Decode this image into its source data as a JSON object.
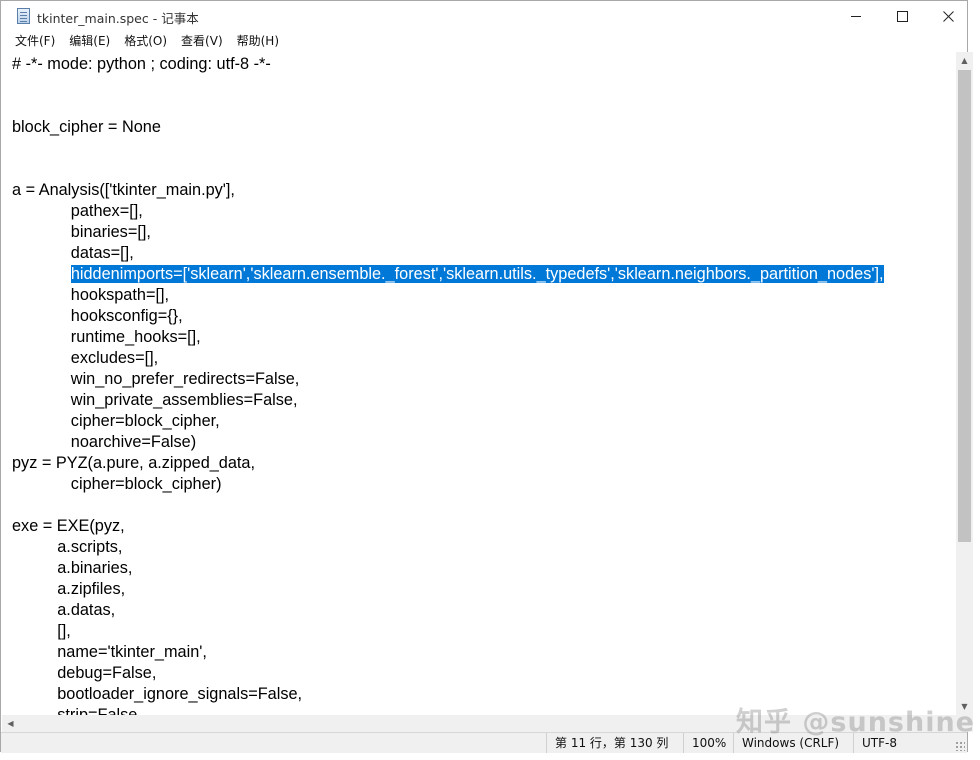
{
  "window": {
    "title": "tkinter_main.spec - 记事本"
  },
  "menu": [
    "文件(F)",
    "编辑(E)",
    "格式(O)",
    "查看(V)",
    "帮助(H)"
  ],
  "editor": {
    "lines": [
      "# -*- mode: python ; coding: utf-8 -*-",
      "",
      "",
      "block_cipher = None",
      "",
      "",
      "a = Analysis(['tkinter_main.py'],",
      "             pathex=[],",
      "             binaries=[],",
      "             datas=[],",
      "             hiddenimports=['sklearn','sklearn.ensemble._forest','sklearn.utils._typedefs','sklearn.neighbors._partition_nodes'],",
      "             hookspath=[],",
      "             hooksconfig={},",
      "             runtime_hooks=[],",
      "             excludes=[],",
      "             win_no_prefer_redirects=False,",
      "             win_private_assemblies=False,",
      "             cipher=block_cipher,",
      "             noarchive=False)",
      "pyz = PYZ(a.pure, a.zipped_data,",
      "             cipher=block_cipher)",
      "",
      "exe = EXE(pyz,",
      "          a.scripts,",
      "          a.binaries,",
      "          a.zipfiles,",
      "          a.datas,",
      "          [],",
      "          name='tkinter_main',",
      "          debug=False,",
      "          bootloader_ignore_signals=False,",
      "          strip=False,"
    ],
    "selected_line_index": 10,
    "selected_text": "hiddenimports=['sklearn','sklearn.ensemble._forest','sklearn.utils._typedefs','sklearn.neighbors._partition_nodes'],",
    "selection_color": "#0078d7"
  },
  "status": {
    "position": "第 11 行，第 130 列",
    "zoom": "100%",
    "line_ending": "Windows (CRLF)",
    "encoding": "UTF-8"
  },
  "watermark": "知乎 @sunshine"
}
